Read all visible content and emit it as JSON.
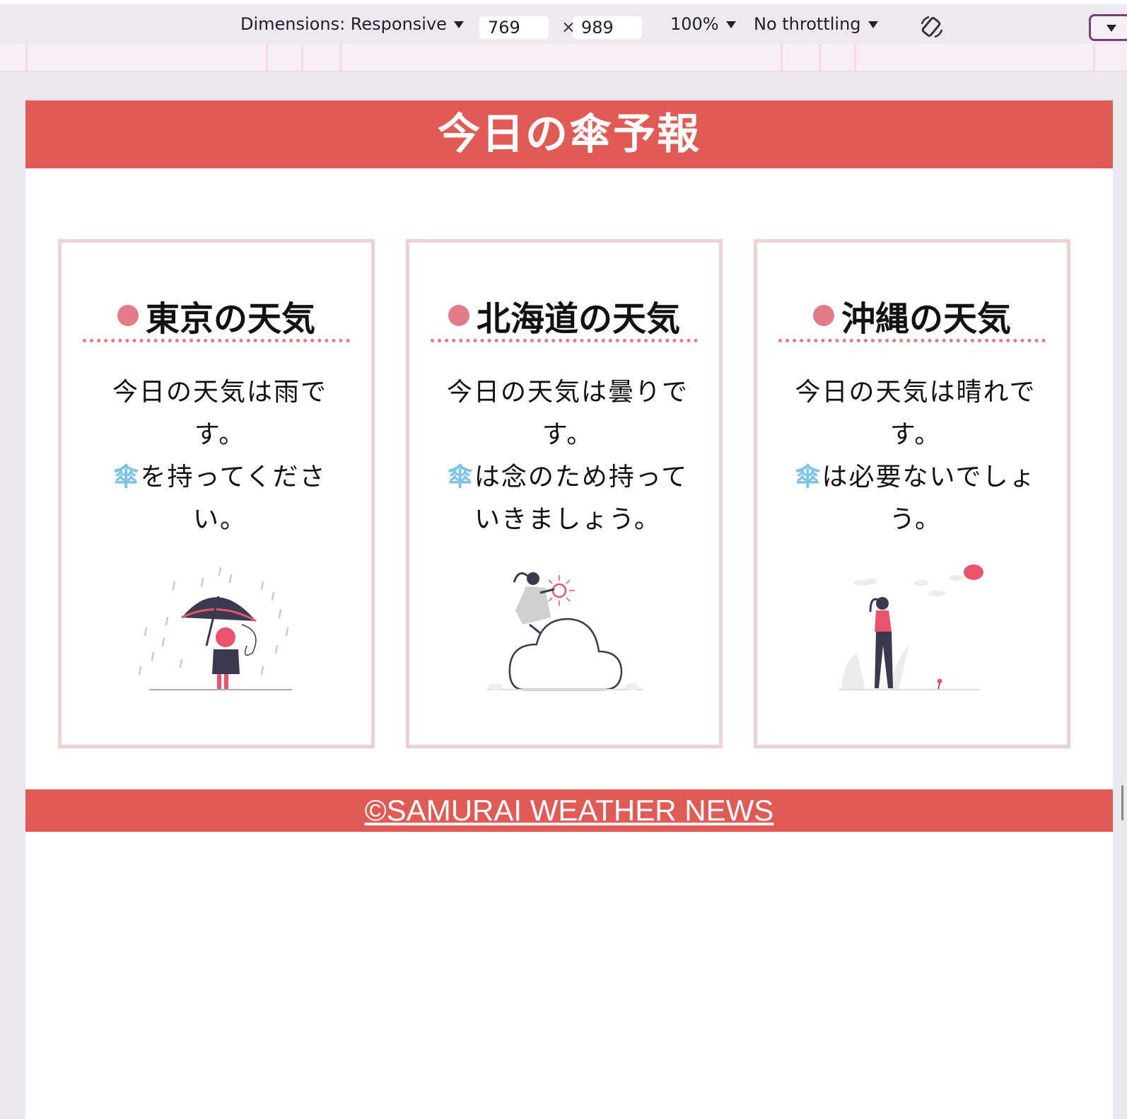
{
  "devtools": {
    "dimensions_label": "Dimensions: Responsive",
    "width_value": "769",
    "times": "×",
    "height_value": "989",
    "zoom_label": "100%",
    "throttling_label": "No throttling"
  },
  "page": {
    "title": "今日の傘予報",
    "footer": "©SAMURAI WEATHER NEWS",
    "colors": {
      "brand": "#e05a56",
      "card_border": "#ecd2d3",
      "dot": "#e27b8a",
      "umbrella_char": "#7dc3e8"
    }
  },
  "cards": [
    {
      "title": "東京の天気",
      "line1": "今日の天気は雨です。",
      "kasa": "傘",
      "line2": "を持ってください。",
      "illustration": "rain-umbrella-illustration"
    },
    {
      "title": "北海道の天気",
      "line1": "今日の天気は曇りです。",
      "kasa": "傘",
      "line2": "は念のため持っていきましょう。",
      "illustration": "cloud-illustration"
    },
    {
      "title": "沖縄の天気",
      "line1": "今日の天気は晴れです。",
      "kasa": "傘",
      "line2": "は必要ないでしょう。",
      "illustration": "sunny-walk-illustration"
    }
  ]
}
